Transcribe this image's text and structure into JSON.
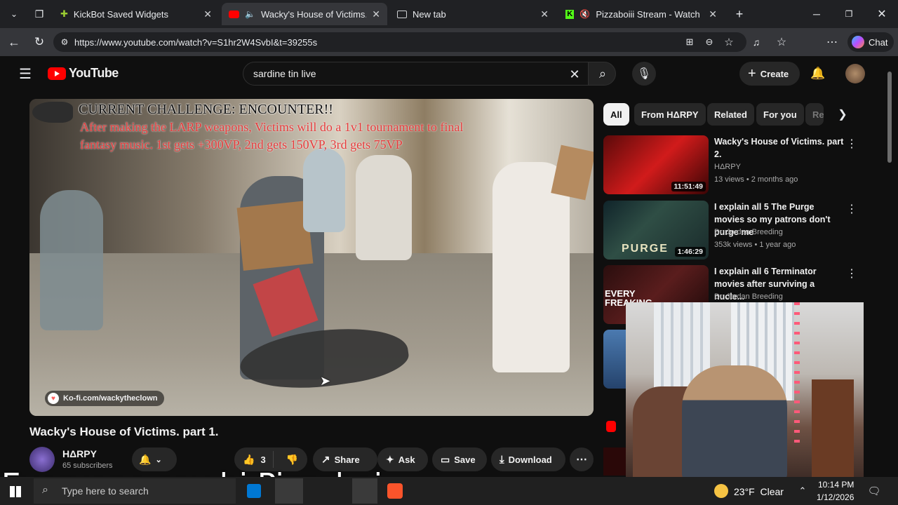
{
  "tabs": [
    {
      "title": "KickBot Saved Widgets",
      "icon": "puzzle-icon",
      "color": "#9acd32"
    },
    {
      "title": "Wacky's House of Victims. par",
      "icon": "youtube-icon",
      "color": "#ff0000",
      "active": true
    },
    {
      "title": "New tab",
      "icon": "newtab-icon"
    },
    {
      "title": "Pizzaboiii Stream - Watch Live",
      "icon": "kick-icon",
      "color": "#53fc18"
    }
  ],
  "address": {
    "url": "https://www.youtube.com/watch?v=S1hr2W4SvbI&t=39255s"
  },
  "browser": {
    "chat_label": "Chat"
  },
  "youtube": {
    "logo_text": "YouTube",
    "search_value": "sardine tin live",
    "create_label": "Create"
  },
  "video": {
    "overlay_title": "CURRENT CHALLENGE: ENCOUNTER!!",
    "overlay_text_1": "After making the LARP weapons, Victims will do a 1v1 tournament to final",
    "overlay_text_2": "fantasy music. 1st gets +300VP, 2nd gets 150VP, 3rd gets 75VP",
    "kofi": "Ko-fi.com/wackytheclown",
    "title": "Wacky's House of Victims. part 1.",
    "channel": "HΔRPY",
    "subscribers": "65 subscribers",
    "likes": "3",
    "share": "Share",
    "ask": "Ask",
    "save": "Save",
    "download": "Download"
  },
  "filters": [
    "All",
    "From HΔRPY",
    "Related",
    "For you",
    "Re"
  ],
  "suggestions": [
    {
      "title": "Wacky's House of Victims. part 2.",
      "channel": "HΔRPY",
      "meta": "13 views • 2 months ago",
      "duration": "11:51:49"
    },
    {
      "title": "I explain all 5 The Purge movies so my patrons don't purge me",
      "channel": "Dr. Jordan Breeding",
      "meta": "353k views • 1 year ago",
      "duration": "1:46:29",
      "thumb_text": "PURGE"
    },
    {
      "title": "I explain all 6 Terminator movies after surviving a nucle...",
      "channel": "Dr. Jordan Breeding",
      "meta": "",
      "duration": "",
      "thumb_text": "EVERY FREAKING"
    }
  ],
  "stream_overlay": "Everyone say hi Pizzaboi",
  "taskbar": {
    "search_placeholder": "Type here to search",
    "weather": "23°F  Clear",
    "time": "10:14 PM",
    "date": "1/12/2026"
  }
}
